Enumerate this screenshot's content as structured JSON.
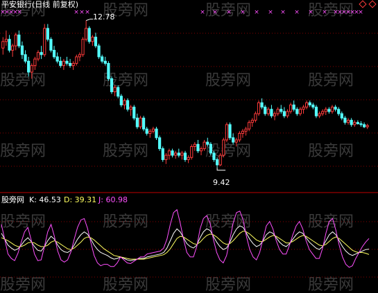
{
  "title": "平安银行(日线 前复权)",
  "watermark": "股旁网",
  "colors": {
    "up": "#ff3b3b",
    "down": "#54ffff",
    "k": "#ffffff",
    "d": "#ffff60",
    "j": "#ff50ff",
    "grid": "#8a0000",
    "marker": "#ff50ff"
  },
  "indicator": {
    "name": "股旁网",
    "k_label": "K: 46.53",
    "d_label": "D: 39.31",
    "j_label": "J: 60.98"
  },
  "chart_data": [
    {
      "type": "candlestick",
      "title": "平安银行(日线 前复权)",
      "annotations": [
        {
          "label": "12.78",
          "value": 12.78
        },
        {
          "label": "9.42",
          "value": 9.42
        }
      ],
      "ylim": [
        9.1,
        12.9
      ],
      "candles": [
        [
          12.15,
          12.4,
          12.0,
          12.3
        ],
        [
          12.3,
          12.55,
          12.2,
          12.35
        ],
        [
          12.35,
          12.45,
          12.05,
          12.1
        ],
        [
          12.1,
          12.25,
          11.95,
          12.2
        ],
        [
          12.2,
          12.5,
          12.1,
          12.45
        ],
        [
          12.45,
          12.55,
          12.15,
          12.2
        ],
        [
          12.2,
          12.3,
          11.9,
          12.0
        ],
        [
          12.0,
          12.1,
          11.8,
          11.85
        ],
        [
          11.85,
          11.95,
          11.5,
          11.6
        ],
        [
          11.6,
          11.8,
          11.45,
          11.75
        ],
        [
          11.75,
          11.95,
          11.65,
          11.9
        ],
        [
          11.9,
          12.1,
          11.85,
          12.05
        ],
        [
          12.05,
          12.2,
          11.9,
          12.0
        ],
        [
          12.0,
          12.7,
          11.95,
          12.6
        ],
        [
          12.6,
          12.7,
          12.3,
          12.35
        ],
        [
          12.35,
          12.4,
          12.05,
          12.1
        ],
        [
          12.1,
          12.2,
          11.9,
          11.95
        ],
        [
          11.95,
          12.05,
          11.8,
          11.85
        ],
        [
          11.85,
          11.95,
          11.7,
          11.75
        ],
        [
          11.75,
          11.9,
          11.65,
          11.85
        ],
        [
          11.85,
          11.95,
          11.75,
          11.8
        ],
        [
          11.8,
          11.9,
          11.7,
          11.75
        ],
        [
          11.75,
          11.85,
          11.65,
          11.8
        ],
        [
          11.8,
          12.0,
          11.75,
          11.95
        ],
        [
          11.95,
          12.05,
          11.85,
          12.0
        ],
        [
          12.0,
          12.4,
          11.95,
          12.35
        ],
        [
          12.35,
          12.78,
          12.3,
          12.6
        ],
        [
          12.6,
          12.65,
          12.25,
          12.3
        ],
        [
          12.3,
          12.45,
          12.2,
          12.4
        ],
        [
          12.4,
          12.5,
          12.15,
          12.2
        ],
        [
          12.2,
          12.25,
          11.9,
          11.95
        ],
        [
          11.95,
          12.0,
          11.8,
          11.85
        ],
        [
          11.85,
          11.95,
          11.75,
          11.8
        ],
        [
          11.8,
          11.85,
          11.4,
          11.45
        ],
        [
          11.45,
          11.5,
          11.1,
          11.15
        ],
        [
          11.15,
          11.3,
          11.05,
          11.25
        ],
        [
          11.25,
          11.3,
          11.0,
          11.05
        ],
        [
          11.05,
          11.1,
          10.8,
          10.85
        ],
        [
          10.85,
          11.0,
          10.75,
          10.95
        ],
        [
          10.95,
          11.0,
          10.7,
          10.75
        ],
        [
          10.75,
          10.85,
          10.6,
          10.8
        ],
        [
          10.8,
          10.85,
          10.5,
          10.55
        ],
        [
          10.55,
          10.65,
          10.3,
          10.35
        ],
        [
          10.35,
          10.6,
          10.3,
          10.55
        ],
        [
          10.55,
          10.6,
          10.25,
          10.3
        ],
        [
          10.3,
          10.35,
          10.15,
          10.2
        ],
        [
          10.2,
          10.3,
          10.1,
          10.25
        ],
        [
          10.25,
          10.35,
          10.2,
          10.3
        ],
        [
          10.3,
          10.35,
          10.05,
          10.1
        ],
        [
          10.1,
          10.15,
          9.8,
          9.85
        ],
        [
          9.85,
          9.9,
          9.55,
          9.6
        ],
        [
          9.6,
          9.75,
          9.5,
          9.7
        ],
        [
          9.7,
          9.85,
          9.6,
          9.8
        ],
        [
          9.8,
          9.85,
          9.65,
          9.7
        ],
        [
          9.7,
          9.8,
          9.62,
          9.75
        ],
        [
          9.75,
          9.85,
          9.65,
          9.7
        ],
        [
          9.7,
          9.8,
          9.6,
          9.75
        ],
        [
          9.75,
          9.8,
          9.55,
          9.6
        ],
        [
          9.6,
          9.7,
          9.52,
          9.65
        ],
        [
          9.65,
          9.95,
          9.6,
          9.9
        ],
        [
          9.9,
          10.0,
          9.8,
          9.95
        ],
        [
          9.95,
          10.05,
          9.75,
          9.8
        ],
        [
          9.8,
          9.9,
          9.7,
          9.85
        ],
        [
          9.85,
          10.05,
          9.8,
          10.0
        ],
        [
          10.0,
          10.1,
          9.9,
          9.95
        ],
        [
          9.95,
          10.0,
          9.7,
          9.75
        ],
        [
          9.75,
          9.8,
          9.55,
          9.6
        ],
        [
          9.6,
          9.65,
          9.42,
          9.48
        ],
        [
          9.48,
          9.75,
          9.45,
          9.7
        ],
        [
          9.7,
          10.1,
          9.65,
          10.05
        ],
        [
          10.05,
          10.45,
          10.0,
          10.4
        ],
        [
          10.4,
          10.45,
          10.05,
          10.1
        ],
        [
          10.1,
          10.2,
          9.95,
          10.0
        ],
        [
          10.0,
          10.1,
          9.9,
          10.05
        ],
        [
          10.05,
          10.25,
          10.0,
          10.2
        ],
        [
          10.2,
          10.3,
          10.1,
          10.25
        ],
        [
          10.25,
          10.35,
          10.15,
          10.3
        ],
        [
          10.3,
          10.5,
          10.25,
          10.45
        ],
        [
          10.45,
          10.55,
          10.35,
          10.5
        ],
        [
          10.5,
          10.7,
          10.45,
          10.65
        ],
        [
          10.65,
          10.95,
          10.6,
          10.9
        ],
        [
          10.9,
          11.0,
          10.75,
          10.8
        ],
        [
          10.8,
          10.85,
          10.6,
          10.65
        ],
        [
          10.65,
          10.8,
          10.6,
          10.75
        ],
        [
          10.75,
          10.85,
          10.55,
          10.6
        ],
        [
          10.6,
          10.7,
          10.5,
          10.65
        ],
        [
          10.65,
          10.8,
          10.6,
          10.75
        ],
        [
          10.75,
          10.85,
          10.65,
          10.7
        ],
        [
          10.7,
          10.8,
          10.55,
          10.6
        ],
        [
          10.6,
          10.75,
          10.55,
          10.7
        ],
        [
          10.7,
          10.9,
          10.65,
          10.85
        ],
        [
          10.85,
          10.95,
          10.7,
          10.75
        ],
        [
          10.75,
          10.8,
          10.6,
          10.65
        ],
        [
          10.65,
          10.8,
          10.6,
          10.75
        ],
        [
          10.75,
          10.85,
          10.65,
          10.8
        ],
        [
          10.8,
          10.95,
          10.75,
          10.9
        ],
        [
          10.9,
          10.95,
          10.8,
          10.85
        ],
        [
          10.85,
          10.9,
          10.75,
          10.8
        ],
        [
          10.8,
          10.85,
          10.55,
          10.6
        ],
        [
          10.6,
          10.7,
          10.55,
          10.65
        ],
        [
          10.65,
          10.75,
          10.6,
          10.7
        ],
        [
          10.7,
          10.8,
          10.62,
          10.75
        ],
        [
          10.75,
          10.8,
          10.65,
          10.7
        ],
        [
          10.7,
          10.85,
          10.65,
          10.8
        ],
        [
          10.8,
          10.85,
          10.7,
          10.75
        ],
        [
          10.75,
          10.8,
          10.6,
          10.65
        ],
        [
          10.65,
          10.7,
          10.5,
          10.55
        ],
        [
          10.55,
          10.6,
          10.4,
          10.45
        ],
        [
          10.45,
          10.55,
          10.4,
          10.5
        ],
        [
          10.5,
          10.55,
          10.35,
          10.4
        ],
        [
          10.4,
          10.5,
          10.35,
          10.45
        ],
        [
          10.45,
          10.5,
          10.4,
          10.42
        ],
        [
          10.42,
          10.48,
          10.35,
          10.4
        ],
        [
          10.4,
          10.45,
          10.32,
          10.35
        ],
        [
          10.35,
          10.42,
          10.3,
          10.38
        ]
      ]
    },
    {
      "type": "line",
      "title": "股旁网",
      "ylim": [
        -10,
        110
      ],
      "series": [
        {
          "name": "K",
          "values": [
            68,
            60,
            52,
            48,
            45,
            47,
            52,
            58,
            62,
            57,
            50,
            45,
            44,
            50,
            58,
            64,
            60,
            52,
            46,
            43,
            42,
            45,
            52,
            60,
            66,
            70,
            67,
            60,
            52,
            46,
            42,
            40,
            38,
            35,
            33,
            34,
            36,
            34,
            32,
            31,
            32,
            33,
            34,
            34,
            36,
            37,
            38,
            39,
            40,
            42,
            48,
            58,
            68,
            74,
            70,
            62,
            54,
            50,
            48,
            52,
            62,
            70,
            74,
            72,
            64,
            56,
            50,
            46,
            48,
            56,
            66,
            74,
            78,
            76,
            68,
            60,
            54,
            50,
            52,
            58,
            66,
            70,
            68,
            62,
            56,
            52,
            50,
            54,
            60,
            66,
            70,
            68,
            62,
            56,
            52,
            48,
            46,
            50,
            58,
            66,
            70,
            66,
            58,
            50,
            44,
            40,
            38,
            40,
            42,
            44,
            46,
            46.53
          ]
        },
        {
          "name": "D",
          "values": [
            62,
            60,
            58,
            55,
            52,
            50,
            50,
            52,
            55,
            56,
            55,
            52,
            50,
            50,
            52,
            56,
            58,
            56,
            53,
            50,
            47,
            46,
            48,
            52,
            56,
            61,
            63,
            62,
            59,
            55,
            51,
            47,
            44,
            41,
            38,
            37,
            36,
            35,
            34,
            33,
            33,
            33,
            33,
            33,
            34,
            35,
            36,
            37,
            38,
            39,
            42,
            47,
            54,
            61,
            64,
            63,
            60,
            57,
            54,
            53,
            56,
            61,
            65,
            67,
            66,
            63,
            59,
            55,
            53,
            54,
            58,
            63,
            68,
            71,
            70,
            67,
            63,
            59,
            57,
            57,
            60,
            63,
            65,
            64,
            61,
            58,
            55,
            55,
            57,
            60,
            63,
            65,
            64,
            61,
            58,
            55,
            52,
            51,
            53,
            57,
            61,
            63,
            61,
            57,
            53,
            49,
            45,
            43,
            42,
            42,
            41,
            39.31
          ]
        },
        {
          "name": "J",
          "values": [
            80,
            60,
            40,
            34,
            31,
            41,
            56,
            70,
            76,
            59,
            40,
            31,
            32,
            50,
            70,
            80,
            64,
            44,
            32,
            29,
            32,
            43,
            60,
            76,
            86,
            88,
            75,
            56,
            38,
            28,
            24,
            26,
            26,
            23,
            23,
            28,
            36,
            32,
            28,
            27,
            30,
            33,
            36,
            36,
            40,
            41,
            42,
            43,
            44,
            48,
            60,
            80,
            96,
            100,
            82,
            60,
            42,
            36,
            36,
            50,
            74,
            88,
            92,
            82,
            60,
            42,
            32,
            28,
            38,
            60,
            82,
            96,
            98,
            86,
            64,
            46,
            36,
            32,
            42,
            60,
            78,
            84,
            74,
            58,
            46,
            40,
            40,
            52,
            66,
            78,
            84,
            74,
            58,
            46,
            40,
            34,
            34,
            48,
            68,
            84,
            88,
            72,
            52,
            36,
            26,
            22,
            24,
            34,
            42,
            50,
            56,
            60.98
          ]
        }
      ]
    }
  ]
}
